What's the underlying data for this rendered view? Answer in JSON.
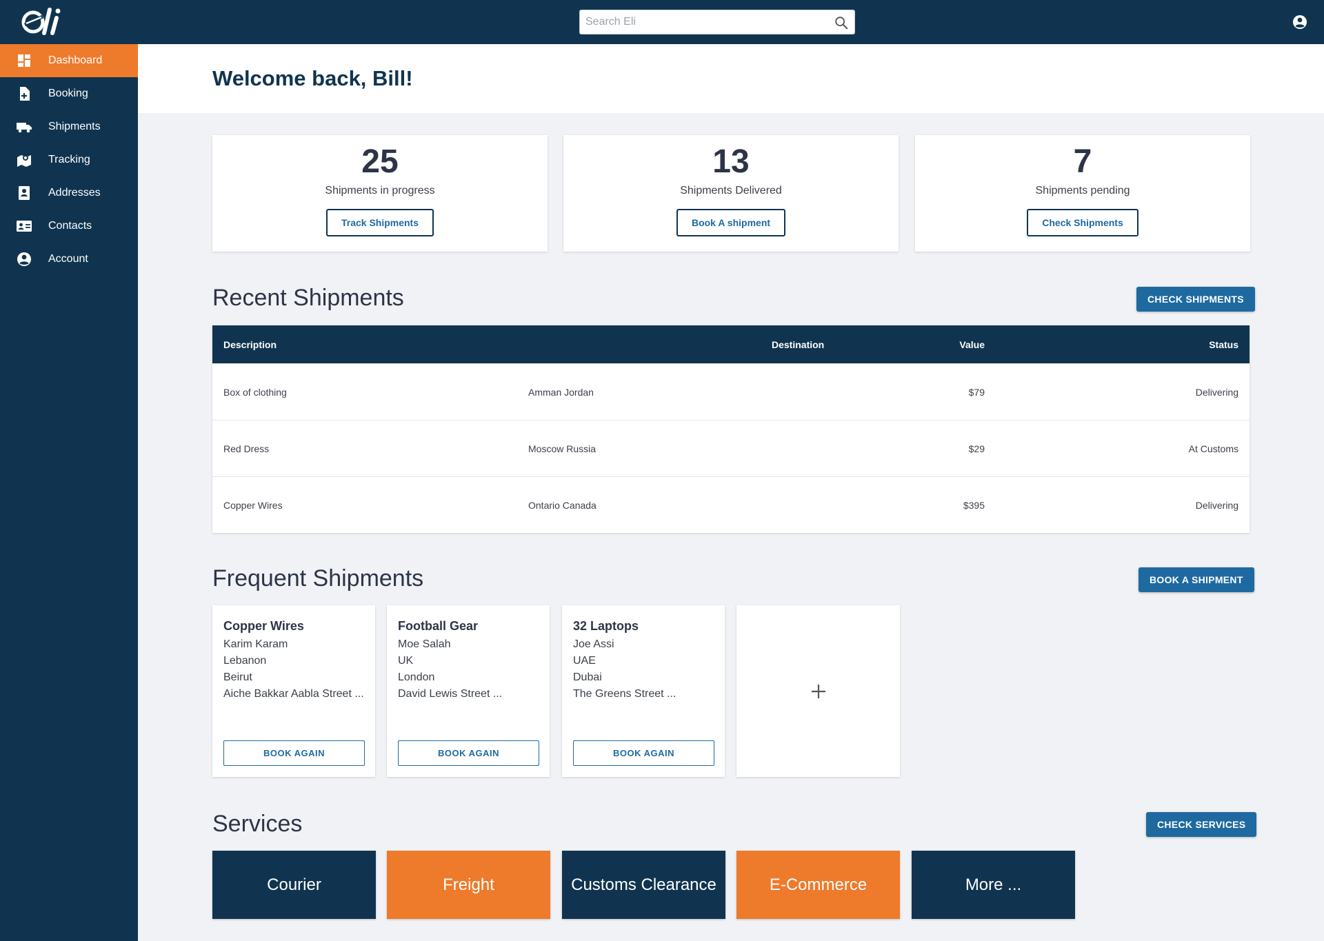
{
  "app": {
    "logo_text": "eli"
  },
  "search": {
    "placeholder": "Search Eli"
  },
  "sidebar": {
    "items": [
      {
        "label": "Dashboard",
        "icon": "dashboard-icon",
        "active": true
      },
      {
        "label": "Booking",
        "icon": "add-document-icon"
      },
      {
        "label": "Shipments",
        "icon": "truck-icon"
      },
      {
        "label": "Tracking",
        "icon": "map-pin-icon"
      },
      {
        "label": "Addresses",
        "icon": "address-book-icon"
      },
      {
        "label": "Contacts",
        "icon": "contact-card-icon"
      },
      {
        "label": "Account",
        "icon": "account-circle-icon"
      }
    ]
  },
  "welcome": "Welcome back, Bill!",
  "stats": [
    {
      "number": "25",
      "label": "Shipments in progress",
      "button": "Track Shipments"
    },
    {
      "number": "13",
      "label": "Shipments Delivered",
      "button": "Book A shipment"
    },
    {
      "number": "7",
      "label": "Shipments pending",
      "button": "Check Shipments"
    }
  ],
  "recent": {
    "title": "Recent Shipments",
    "button": "CHECK SHIPMENTS",
    "headers": {
      "description": "Description",
      "destination": "Destination",
      "value": "Value",
      "status": "Status"
    },
    "rows": [
      {
        "description": "Box of clothing",
        "destination": "Amman Jordan",
        "value": "$79",
        "status": "Delivering"
      },
      {
        "description": "Red Dress",
        "destination": "Moscow Russia",
        "value": "$29",
        "status": "At Customs"
      },
      {
        "description": "Copper Wires",
        "destination": "Ontario Canada",
        "value": "$395",
        "status": "Delivering"
      }
    ]
  },
  "frequent": {
    "title": "Frequent Shipments",
    "button": "BOOK A SHIPMENT",
    "book_again": "BOOK AGAIN",
    "cards": [
      {
        "title": "Copper Wires",
        "name": "Karim Karam",
        "country": "Lebanon",
        "city": "Beirut",
        "street": "Aiche Bakkar Aabla Street ..."
      },
      {
        "title": "Football Gear",
        "name": "Moe Salah",
        "country": "UK",
        "city": "London",
        "street": "David Lewis Street ..."
      },
      {
        "title": "32 Laptops",
        "name": "Joe Assi",
        "country": "UAE",
        "city": "Dubai",
        "street": "The Greens Street ..."
      }
    ]
  },
  "services": {
    "title": "Services",
    "button": "CHECK SERVICES",
    "items": [
      "Courier",
      "Freight",
      "Customs Clearance",
      "E-Commerce",
      "More ..."
    ]
  },
  "colors": {
    "navy": "#10344f",
    "orange": "#ee7a2b",
    "blue": "#1e6aa0",
    "background": "#f0f2f5"
  }
}
